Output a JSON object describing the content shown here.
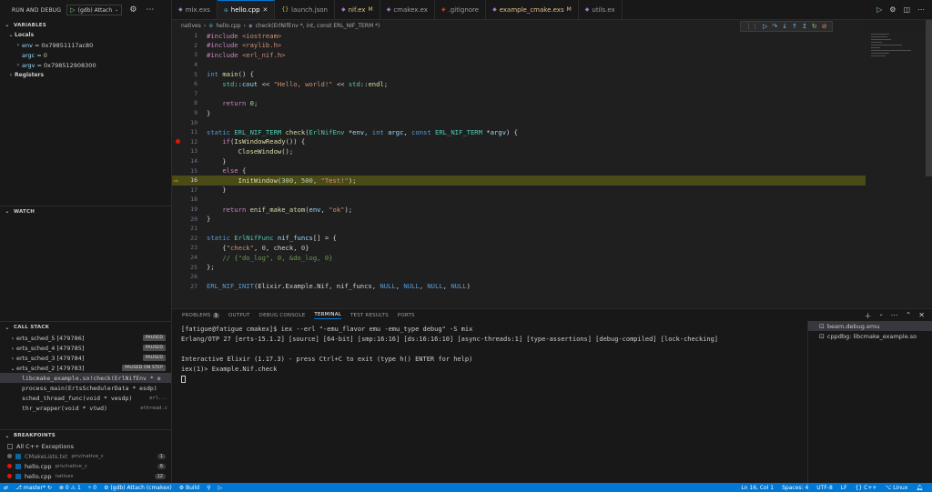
{
  "sidebar": {
    "run_label": "RUN AND DEBUG",
    "config_name": "(gdb) Attach",
    "variables_title": "VARIABLES",
    "locals_label": "Locals",
    "locals": [
      {
        "name": "env",
        "value": "0x79851117ac80",
        "expandable": true
      },
      {
        "name": "argc",
        "value": "0",
        "expandable": false
      },
      {
        "name": "argv",
        "value": "0x798512908300",
        "expandable": true
      }
    ],
    "registers_label": "Registers",
    "watch_title": "WATCH",
    "callstack_title": "CALL STACK",
    "threads": [
      {
        "name": "erts_sched_5 [479786]",
        "status": "PAUSED"
      },
      {
        "name": "erts_sched_4 [479785]",
        "status": "PAUSED"
      },
      {
        "name": "erts_sched_3 [479784]",
        "status": "PAUSED"
      },
      {
        "name": "erts_sched_2 [479783]",
        "status": "PAUSED ON STEP"
      }
    ],
    "frames": [
      {
        "fn": "libcmake_example.so!check(ErlNifEnv * e",
        "file": ""
      },
      {
        "fn": "process_main(ErtsSchedulerData * esdp)",
        "file": ""
      },
      {
        "fn": "sched_thread_func(void * vesdp)",
        "file": "erl..."
      },
      {
        "fn": "thr_wrapper(void * vtwd)",
        "file": "ethread.c"
      }
    ],
    "breakpoints_title": "BREAKPOINTS",
    "breakpoints": [
      {
        "label": "All C++ Exceptions",
        "path": "",
        "count": "",
        "kind": "exception"
      },
      {
        "label": "CMakeLists.txt",
        "path": "priv/native_c",
        "count": "1",
        "kind": "disabled"
      },
      {
        "label": "hello.cpp",
        "path": "priv/native_c",
        "count": "6",
        "kind": "active"
      },
      {
        "label": "hello.cpp",
        "path": "natives",
        "count": "12",
        "kind": "active"
      }
    ]
  },
  "tabs": [
    {
      "label": "mix.exs",
      "icon": "elixir-icon",
      "modified": "",
      "active": false
    },
    {
      "label": "hello.cpp",
      "icon": "cpp-icon",
      "modified": "",
      "active": true
    },
    {
      "label": "launch.json",
      "icon": "json-icon",
      "modified": "",
      "active": false
    },
    {
      "label": "nif.ex",
      "icon": "elixir-icon",
      "modified": "M",
      "active": false
    },
    {
      "label": "cmakex.ex",
      "icon": "elixir-icon",
      "modified": "",
      "active": false
    },
    {
      "label": ".gitignore",
      "icon": "git-icon",
      "modified": "",
      "active": false
    },
    {
      "label": "example_cmake.exs",
      "icon": "elixir-icon",
      "modified": "M",
      "active": false
    },
    {
      "label": "utils.ex",
      "icon": "elixir-icon",
      "modified": "",
      "active": false
    }
  ],
  "breadcrumb": {
    "folder": "natives",
    "file": "hello.cpp",
    "symbol": "check(ErlNifEnv *, int, const ERL_NIF_TERM *)"
  },
  "editor": {
    "current_line": 16,
    "breakpoint_lines": [
      12
    ],
    "lines": [
      {
        "n": "1",
        "t": [
          [
            "pre",
            "#include "
          ],
          [
            "str",
            "<iostream>"
          ]
        ]
      },
      {
        "n": "2",
        "t": [
          [
            "pre",
            "#include "
          ],
          [
            "str",
            "<raylib.h>"
          ]
        ]
      },
      {
        "n": "3",
        "t": [
          [
            "pre",
            "#include "
          ],
          [
            "str",
            "<erl_nif.h>"
          ]
        ]
      },
      {
        "n": "4",
        "t": []
      },
      {
        "n": "5",
        "t": [
          [
            "kw",
            "int "
          ],
          [
            "fnc",
            "main"
          ],
          [
            "plain",
            "() {"
          ]
        ]
      },
      {
        "n": "6",
        "t": [
          [
            "plain",
            "    "
          ],
          [
            "ty",
            "std"
          ],
          [
            "plain",
            "::"
          ],
          [
            "par",
            "cout"
          ],
          [
            "plain",
            " << "
          ],
          [
            "str",
            "\"Hello, world!\""
          ],
          [
            "plain",
            " << "
          ],
          [
            "ty",
            "std"
          ],
          [
            "plain",
            "::"
          ],
          [
            "fnc",
            "endl"
          ],
          [
            "plain",
            ";"
          ]
        ]
      },
      {
        "n": "7",
        "t": []
      },
      {
        "n": "8",
        "t": [
          [
            "plain",
            "    "
          ],
          [
            "ctl",
            "return "
          ],
          [
            "num",
            "0"
          ],
          [
            "plain",
            ";"
          ]
        ]
      },
      {
        "n": "9",
        "t": [
          [
            "plain",
            "}"
          ]
        ]
      },
      {
        "n": "10",
        "t": []
      },
      {
        "n": "11",
        "t": [
          [
            "kw",
            "static "
          ],
          [
            "ty",
            "ERL_NIF_TERM "
          ],
          [
            "fnc",
            "check"
          ],
          [
            "plain",
            "("
          ],
          [
            "ty",
            "ErlNifEnv "
          ],
          [
            "plain",
            "*"
          ],
          [
            "par",
            "env"
          ],
          [
            "plain",
            ", "
          ],
          [
            "kw",
            "int "
          ],
          [
            "par",
            "argc"
          ],
          [
            "plain",
            ", "
          ],
          [
            "kw",
            "const "
          ],
          [
            "ty",
            "ERL_NIF_TERM "
          ],
          [
            "plain",
            "*"
          ],
          [
            "par",
            "argv"
          ],
          [
            "plain",
            ") {"
          ]
        ]
      },
      {
        "n": "12",
        "t": [
          [
            "plain",
            "    "
          ],
          [
            "ctl",
            "if"
          ],
          [
            "plain",
            "("
          ],
          [
            "fnc",
            "IsWindowReady"
          ],
          [
            "plain",
            "()) {"
          ]
        ]
      },
      {
        "n": "13",
        "t": [
          [
            "plain",
            "        "
          ],
          [
            "fnc",
            "CloseWindow"
          ],
          [
            "plain",
            "();"
          ]
        ]
      },
      {
        "n": "14",
        "t": [
          [
            "plain",
            "    }"
          ]
        ]
      },
      {
        "n": "15",
        "t": [
          [
            "plain",
            "    "
          ],
          [
            "ctl",
            "else "
          ],
          [
            "plain",
            "{"
          ]
        ]
      },
      {
        "n": "16",
        "t": [
          [
            "plain",
            "        "
          ],
          [
            "fnc",
            "InitWindow"
          ],
          [
            "plain",
            "("
          ],
          [
            "num",
            "300"
          ],
          [
            "plain",
            ", "
          ],
          [
            "num",
            "500"
          ],
          [
            "plain",
            ", "
          ],
          [
            "str",
            "\"Test!\""
          ],
          [
            "plain",
            ");"
          ]
        ]
      },
      {
        "n": "17",
        "t": [
          [
            "plain",
            "    }"
          ]
        ]
      },
      {
        "n": "18",
        "t": []
      },
      {
        "n": "19",
        "t": [
          [
            "plain",
            "    "
          ],
          [
            "ctl",
            "return "
          ],
          [
            "fnc",
            "enif_make_atom"
          ],
          [
            "plain",
            "("
          ],
          [
            "par",
            "env"
          ],
          [
            "plain",
            ", "
          ],
          [
            "str",
            "\"ok\""
          ],
          [
            "plain",
            ");"
          ]
        ]
      },
      {
        "n": "20",
        "t": [
          [
            "plain",
            "}"
          ]
        ]
      },
      {
        "n": "21",
        "t": []
      },
      {
        "n": "22",
        "t": [
          [
            "kw",
            "static "
          ],
          [
            "ty",
            "ErlNifFunc "
          ],
          [
            "par",
            "nif_funcs"
          ],
          [
            "plain",
            "[] = {"
          ]
        ]
      },
      {
        "n": "23",
        "t": [
          [
            "plain",
            "    {"
          ],
          [
            "str",
            "\"check\""
          ],
          [
            "plain",
            ", "
          ],
          [
            "num",
            "0"
          ],
          [
            "plain",
            ", check, "
          ],
          [
            "num",
            "0"
          ],
          [
            "plain",
            "}"
          ]
        ]
      },
      {
        "n": "24",
        "t": [
          [
            "plain",
            "    "
          ],
          [
            "cmt",
            "// {\"do_log\", 0, &do_log, 0}"
          ]
        ]
      },
      {
        "n": "25",
        "t": [
          [
            "plain",
            "};"
          ]
        ]
      },
      {
        "n": "26",
        "t": []
      },
      {
        "n": "27",
        "t": [
          [
            "mac",
            "ERL_NIF_INIT"
          ],
          [
            "plain",
            "(Elixir.Example.Nif, nif_funcs, "
          ],
          [
            "mac",
            "NULL"
          ],
          [
            "plain",
            ", "
          ],
          [
            "mac",
            "NULL"
          ],
          [
            "plain",
            ", "
          ],
          [
            "mac",
            "NULL"
          ],
          [
            "plain",
            ", "
          ],
          [
            "mac",
            "NULL"
          ],
          [
            "plain",
            ")"
          ]
        ]
      }
    ]
  },
  "panel": {
    "tabs": [
      {
        "label": "PROBLEMS",
        "count": "1",
        "active": false
      },
      {
        "label": "OUTPUT",
        "count": "",
        "active": false
      },
      {
        "label": "DEBUG CONSOLE",
        "count": "",
        "active": false
      },
      {
        "label": "TERMINAL",
        "count": "",
        "active": true
      },
      {
        "label": "TEST RESULTS",
        "count": "",
        "active": false
      },
      {
        "label": "PORTS",
        "count": "",
        "active": false
      }
    ],
    "terminal_lines": [
      "[fatigue@fatigue cmakex]$ iex --erl \"-emu_flavor emu -emu_type debug\" -S mix",
      "Erlang/OTP 27 [erts-15.1.2] [source] [64-bit] [smp:16:16] [ds:16:16:10] [async-threads:1] [type-assertions] [debug-compiled] [lock-checking]",
      "",
      "Interactive Elixir (1.17.3) - press Ctrl+C to exit (type h() ENTER for help)",
      "iex(1)> Example.Nif.check"
    ],
    "terminals": [
      {
        "label": "beam.debug.emu",
        "selected": true
      },
      {
        "label": "cppdbg: libcmake_example.so",
        "selected": false
      }
    ]
  },
  "status": {
    "branch": "master*",
    "errors": "0",
    "warnings": "1",
    "ports": "0",
    "debug_target": "(gdb) Attach (cmakex)",
    "build": "Build",
    "position": "Ln 16, Col 1",
    "spaces": "Spaces: 4",
    "encoding": "UTF-8",
    "eol": "LF",
    "language": "C++",
    "platform": "Linux"
  }
}
